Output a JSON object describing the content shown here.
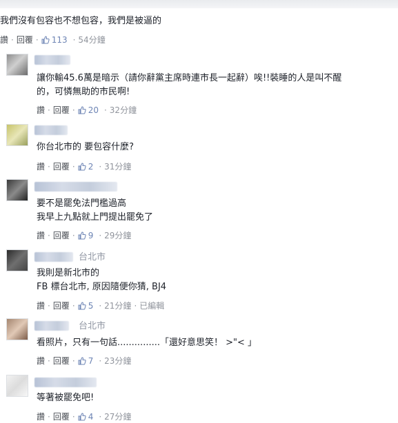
{
  "labels": {
    "like": "讚",
    "reply": "回覆",
    "separator": "·",
    "edited": "已編輯"
  },
  "icons": {
    "like": "thumbs-up-icon"
  },
  "colors": {
    "like_count": "#6d84b4",
    "meta": "#90949c"
  },
  "root": {
    "text": "我們沒有包容也不想包容，我們是被逼的",
    "likes": "113",
    "time": "54分鐘"
  },
  "replies": [
    {
      "location": "",
      "lines": [
        "讓你輸45.6萬是暗示（請你辭黨主席時連市長一起辭）唉!!裝睡的人是叫不醒",
        "的，可憐無助的市民啊!"
      ],
      "likes": "20",
      "time": "32分鐘"
    },
    {
      "location": "",
      "lines": [
        "你台北市的 要包容什麼?"
      ],
      "likes": "2",
      "time": "31分鐘"
    },
    {
      "location": "",
      "lines": [
        "要不是罷免法門檻過高",
        "我早上九點就上門提出罷免了"
      ],
      "likes": "9",
      "time": "29分鐘"
    },
    {
      "location": "台北市",
      "lines": [
        "我則是新北市的",
        "FB 標台北市, 原因隨便你猜, BJ4"
      ],
      "likes": "5",
      "time": "21分鐘"
    },
    {
      "location": "台北市",
      "lines": [
        "看照片，只有一句話...............「還好意思笑！ >\"< 」"
      ],
      "likes": "7",
      "time": "23分鐘"
    },
    {
      "location": "",
      "lines": [
        "等著被罷免吧!"
      ],
      "likes": "4",
      "time": "27分鐘"
    }
  ]
}
